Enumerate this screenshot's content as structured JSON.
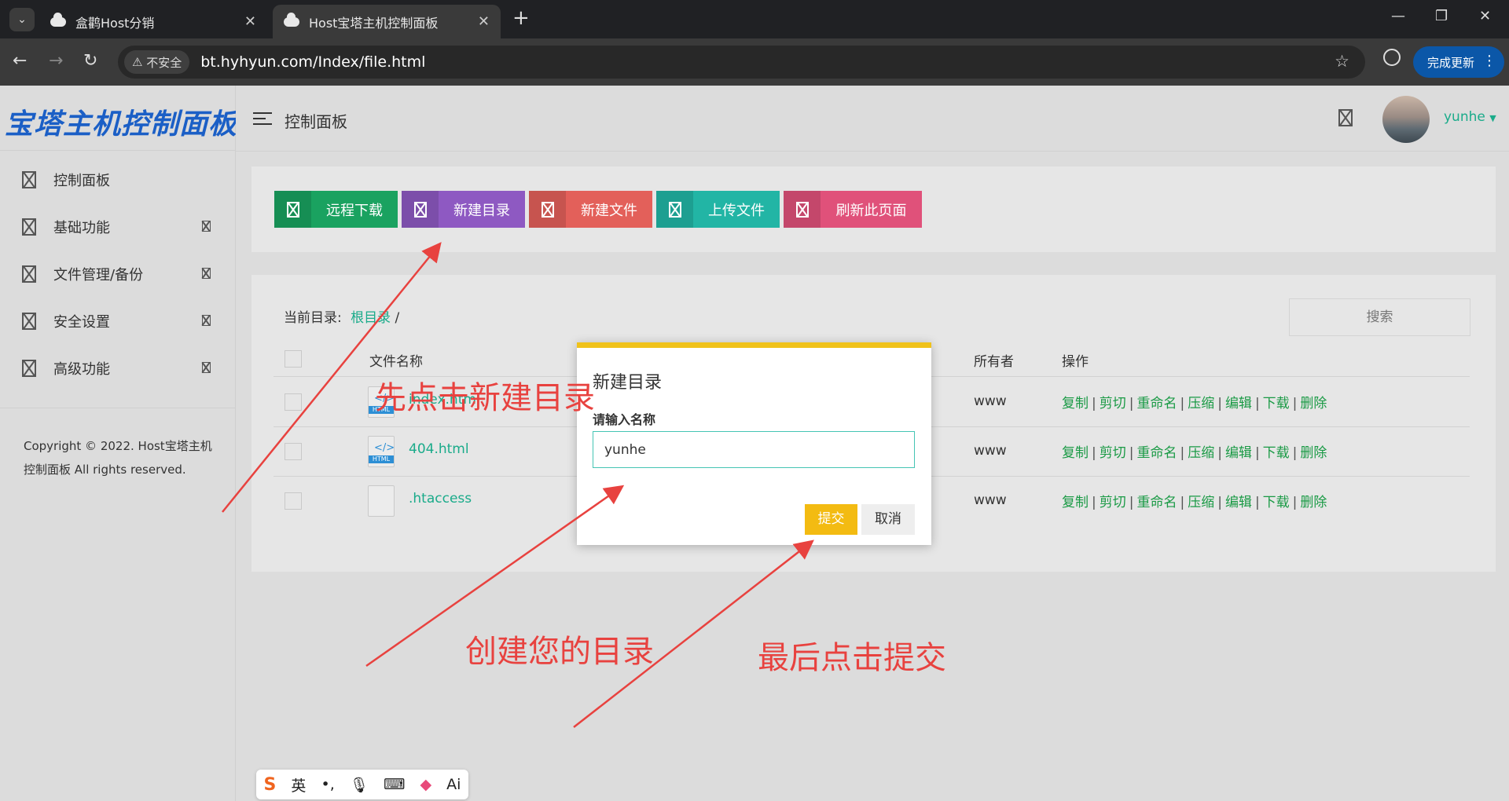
{
  "browser": {
    "tabs": [
      {
        "title": "盒鹳Host分销"
      },
      {
        "title": "Host宝塔主机控制面板"
      }
    ],
    "security_label": "不安全",
    "url": "bt.hyhyun.com/Index/file.html",
    "update_label": "完成更新"
  },
  "sidebar": {
    "brand": "宝塔主机控制面板",
    "items": [
      {
        "label": "控制面板"
      },
      {
        "label": "基础功能"
      },
      {
        "label": "文件管理/备份"
      },
      {
        "label": "安全设置"
      },
      {
        "label": "高级功能"
      }
    ],
    "copyright": "Copyright © 2022. Host宝塔主机控制面板 All rights reserved."
  },
  "header": {
    "title": "控制面板",
    "username": "yunhe"
  },
  "toolbar": {
    "buttons": [
      {
        "label": "远程下载",
        "color": "#1aa260"
      },
      {
        "label": "新建目录",
        "color": "#8e59c2"
      },
      {
        "label": "新建文件",
        "color": "#e3605a"
      },
      {
        "label": "上传文件",
        "color": "#22b5a5"
      },
      {
        "label": "刷新此页面",
        "color": "#e0517a"
      }
    ]
  },
  "files": {
    "current_dir_label": "当前目录:",
    "root_label": "根目录",
    "separator": "/",
    "search_placeholder": "搜索",
    "columns": {
      "name": "文件名称",
      "owner": "所有者",
      "ops": "操作"
    },
    "rows": [
      {
        "name": "index.html",
        "owner": "www"
      },
      {
        "name": "404.html",
        "owner": "www"
      },
      {
        "name": ".htaccess",
        "owner": "www"
      }
    ],
    "operations": [
      "复制",
      "剪切",
      "重命名",
      "压缩",
      "编辑",
      "下载",
      "删除"
    ]
  },
  "modal": {
    "title": "新建目录",
    "label": "请输入名称",
    "input_value": "yunhe",
    "submit_label": "提交",
    "cancel_label": "取消"
  },
  "annotations": {
    "step1": "先点击新建目录",
    "step2": "创建您的目录",
    "step3": "最后点击提交",
    "color": "#e8423f"
  },
  "ime": {
    "logo": "S",
    "mode": "英",
    "punct": "•,",
    "ai": "Ai"
  }
}
